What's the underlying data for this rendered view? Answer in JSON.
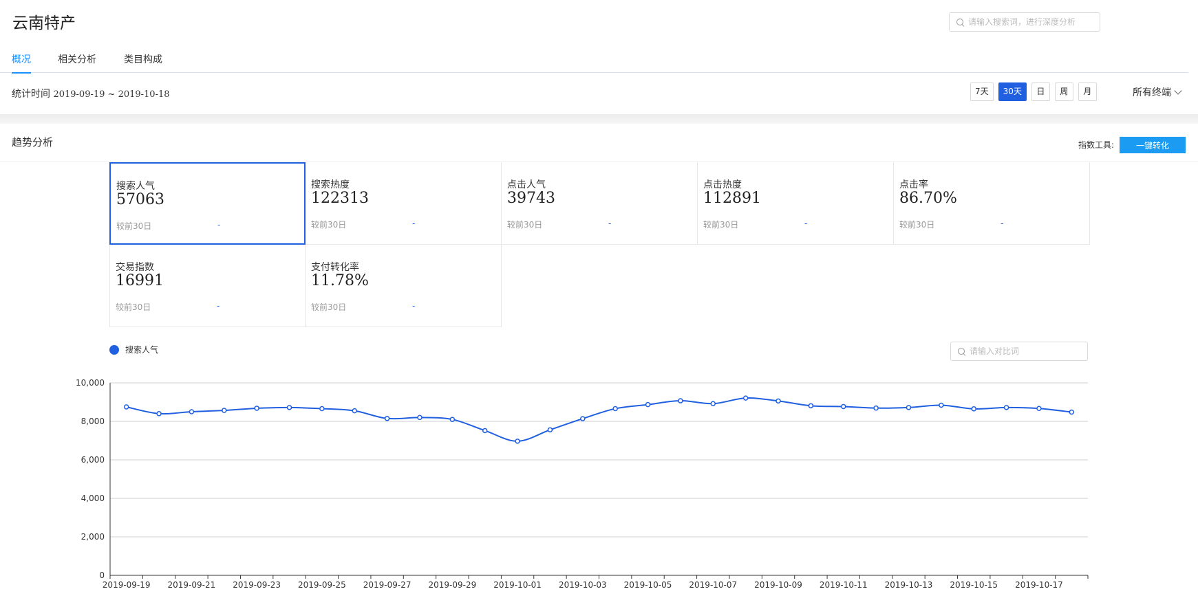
{
  "header": {
    "title": "云南特产",
    "search_placeholder": "请输入搜索词，进行深度分析"
  },
  "tabs": [
    {
      "label": "概况",
      "active": true
    },
    {
      "label": "相关分析",
      "active": false
    },
    {
      "label": "类目构成",
      "active": false
    }
  ],
  "stat": {
    "label": "统计时间",
    "range": "2019-09-19 ~ 2019-10-18"
  },
  "range_buttons": [
    {
      "label": "7天",
      "active": false
    },
    {
      "label": "30天",
      "active": true
    },
    {
      "label": "日",
      "active": false
    },
    {
      "label": "周",
      "active": false
    },
    {
      "label": "月",
      "active": false
    }
  ],
  "device_select": "所有终端",
  "trend": {
    "title": "趋势分析",
    "tool_label": "指数工具:",
    "convert_button": "一键转化"
  },
  "metrics": [
    {
      "name": "搜索人气",
      "value": "57063",
      "compare": "较前30日",
      "delta": "-",
      "selected": true
    },
    {
      "name": "搜索热度",
      "value": "122313",
      "compare": "较前30日",
      "delta": "-",
      "selected": false
    },
    {
      "name": "点击人气",
      "value": "39743",
      "compare": "较前30日",
      "delta": "-",
      "selected": false
    },
    {
      "name": "点击热度",
      "value": "112891",
      "compare": "较前30日",
      "delta": "-",
      "selected": false
    },
    {
      "name": "点击率",
      "value": "86.70%",
      "compare": "较前30日",
      "delta": "-",
      "selected": false
    },
    {
      "name": "交易指数",
      "value": "16991",
      "compare": "较前30日",
      "delta": "-",
      "selected": false
    },
    {
      "name": "支付转化率",
      "value": "11.78%",
      "compare": "较前30日",
      "delta": "-",
      "selected": false
    }
  ],
  "legend_label": "搜索人气",
  "compare_search_placeholder": "请输入对比词",
  "colors": {
    "accent": "#1f5fe0",
    "convert_button": "#1b9cf2",
    "tab_active": "#1890ff"
  },
  "chart_data": {
    "type": "line",
    "x": [
      "2019-09-19",
      "2019-09-20",
      "2019-09-21",
      "2019-09-22",
      "2019-09-23",
      "2019-09-24",
      "2019-09-25",
      "2019-09-26",
      "2019-09-27",
      "2019-09-28",
      "2019-09-29",
      "2019-09-30",
      "2019-10-01",
      "2019-10-02",
      "2019-10-03",
      "2019-10-04",
      "2019-10-05",
      "2019-10-06",
      "2019-10-07",
      "2019-10-08",
      "2019-10-09",
      "2019-10-10",
      "2019-10-11",
      "2019-10-12",
      "2019-10-13",
      "2019-10-14",
      "2019-10-15",
      "2019-10-16",
      "2019-10-17",
      "2019-10-18"
    ],
    "x_tick_labels": [
      "2019-09-19",
      "2019-09-21",
      "2019-09-23",
      "2019-09-25",
      "2019-09-27",
      "2019-09-29",
      "2019-10-01",
      "2019-10-03",
      "2019-10-05",
      "2019-10-07",
      "2019-10-09",
      "2019-10-11",
      "2019-10-13",
      "2019-10-15",
      "2019-10-17"
    ],
    "series": [
      {
        "name": "搜索人气",
        "values": [
          8750,
          8400,
          8500,
          8570,
          8680,
          8720,
          8660,
          8550,
          8150,
          8200,
          8100,
          7520,
          6970,
          7560,
          8140,
          8660,
          8870,
          9070,
          8920,
          9210,
          9060,
          8810,
          8770,
          8690,
          8720,
          8840,
          8650,
          8720,
          8670,
          8480
        ]
      }
    ],
    "ylim": [
      0,
      10000
    ],
    "y_ticks": [
      "0",
      "2,000",
      "4,000",
      "6,000",
      "8,000",
      "10,000"
    ],
    "y_tick_values": [
      0,
      2000,
      4000,
      6000,
      8000,
      10000
    ],
    "grid": true,
    "xlabel": "",
    "ylabel": "",
    "title": ""
  }
}
